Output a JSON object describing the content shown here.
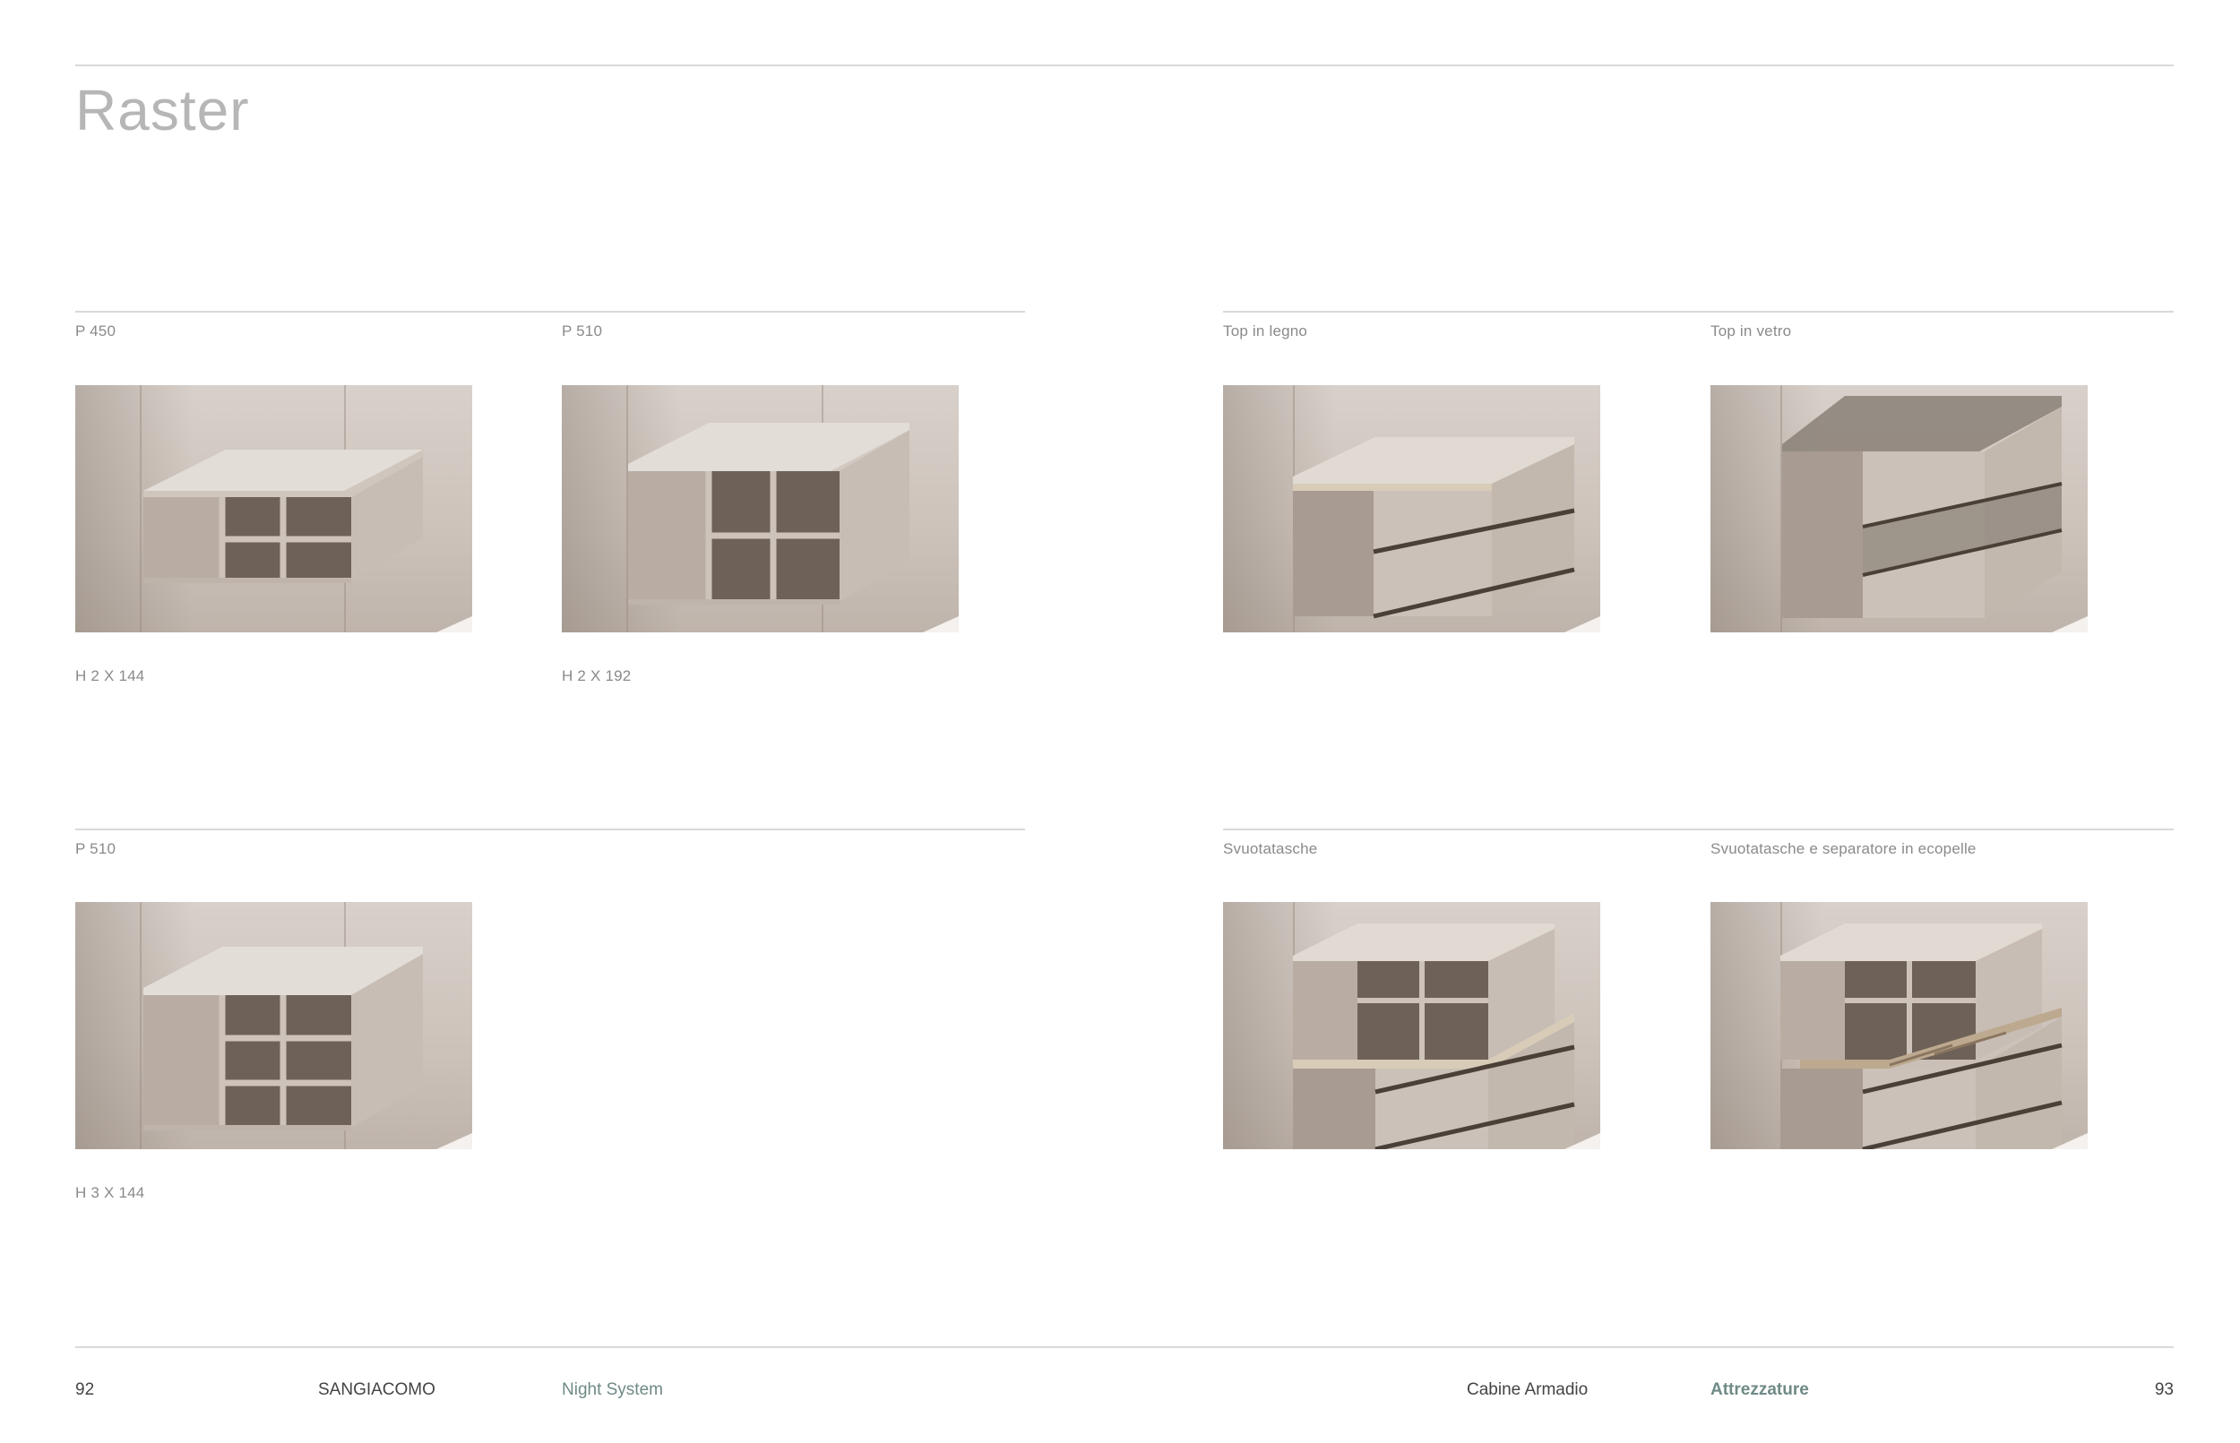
{
  "page": {
    "title": "Raster"
  },
  "sections": [
    {
      "id": "p450",
      "label": "P 450",
      "caption": "H 2 X 144"
    },
    {
      "id": "p510-a",
      "label": "P 510",
      "caption": "H 2 X 192"
    },
    {
      "id": "top-legno",
      "label": "Top in legno",
      "caption": ""
    },
    {
      "id": "top-vetro",
      "label": "Top in vetro",
      "caption": ""
    },
    {
      "id": "p510-b",
      "label": "P 510",
      "caption": "H 3 X 144"
    },
    {
      "id": "svuotatasche",
      "label": "Svuotatasche",
      "caption": ""
    },
    {
      "id": "svuotatasche-ecopelle",
      "label": "Svuotatasche e separatore in ecopelle",
      "caption": ""
    }
  ],
  "footer": {
    "page_left": "92",
    "brand": "SANGIACOMO",
    "collection": "Night System",
    "category": "Cabine Armadio",
    "subcategory": "Attrezzature",
    "page_right": "93"
  },
  "colors": {
    "accent": "#6f8a86",
    "wall": "#d3cac3",
    "unit": "#c9bfb6"
  }
}
